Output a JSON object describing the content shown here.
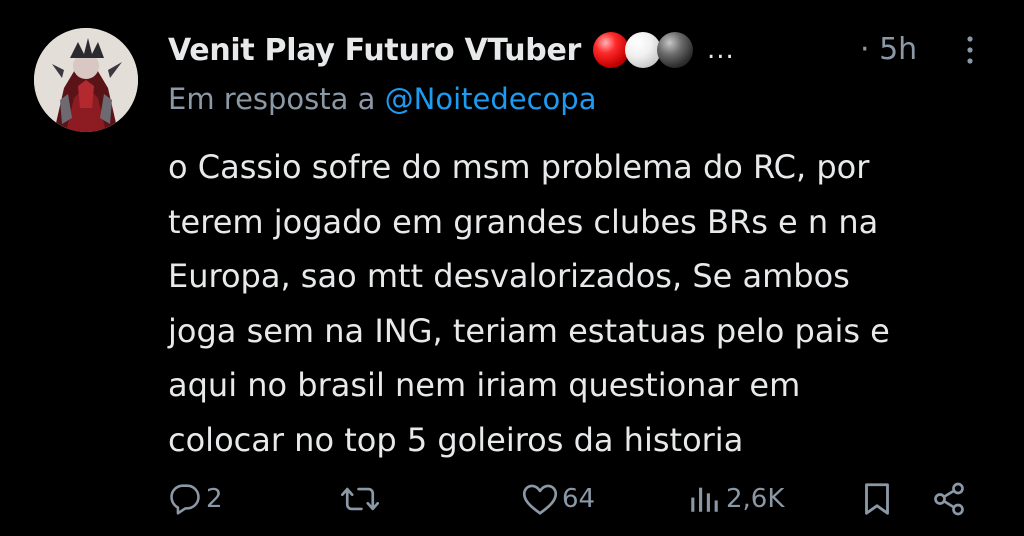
{
  "tweet": {
    "author": {
      "display_name": "Venit Play Futuro VTuber",
      "avatar_icon": "avatar-icon",
      "badges": [
        "red-ball",
        "white-ball",
        "black-ball"
      ],
      "truncation": "..."
    },
    "time": "· 5h",
    "reply_prefix": "Em resposta a",
    "reply_handle": "@Noitedecopa",
    "text_lines": [
      "o Cassio sofre do msm problema do RC, por",
      "terem jogado em grandes clubes BRs e n na",
      "Europa, sao mtt desvalorizados, Se ambos",
      "joga sem na ING, teriam estatuas pelo pais e",
      "aqui no brasil nem iriam questionar em",
      "colocar no top 5 goleiros da historia"
    ],
    "actions": {
      "reply_count": "2",
      "retweet_count": "",
      "like_count": "64",
      "views_count": "2,6K"
    }
  },
  "colors": {
    "background": "#000000",
    "text_primary": "#e7e9ea",
    "text_secondary": "#8b98a5",
    "link": "#1d9bf0"
  },
  "icons": {
    "more": "more-vertical-icon",
    "reply": "reply-icon",
    "retweet": "retweet-icon",
    "like": "heart-icon",
    "views": "views-icon",
    "bookmark": "bookmark-icon",
    "share": "share-icon"
  }
}
